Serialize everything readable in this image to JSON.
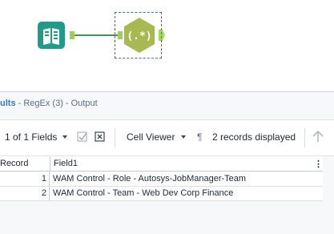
{
  "workflow": {
    "input_tool_icon": "book-input-icon",
    "regex_tool_icon": "regex-hexagon-icon",
    "regex_tool_label": "(.*)",
    "colors": {
      "input_tool": "#1f9b89",
      "regex_tool": "#a8b952",
      "connector": "#3d9a4c",
      "selection": "#3a70c4"
    }
  },
  "results": {
    "title_prefix": "ults",
    "title_suffix": " - RegEx (3) - Output",
    "toolbar": {
      "fields_label": "1 of 1 Fields",
      "viewer_label": "Cell Viewer",
      "paragraph_icon": "¶",
      "records_label": "2 records displayed"
    },
    "grid": {
      "columns": [
        "Record",
        "Field1"
      ],
      "rows": [
        {
          "record": "1",
          "field1": "WAM Control - Role - Autosys-JobManager-Team"
        },
        {
          "record": "2",
          "field1": "WAM Control - Team - Web Dev Corp Finance"
        }
      ],
      "column_menu_icon": "⋮"
    }
  }
}
